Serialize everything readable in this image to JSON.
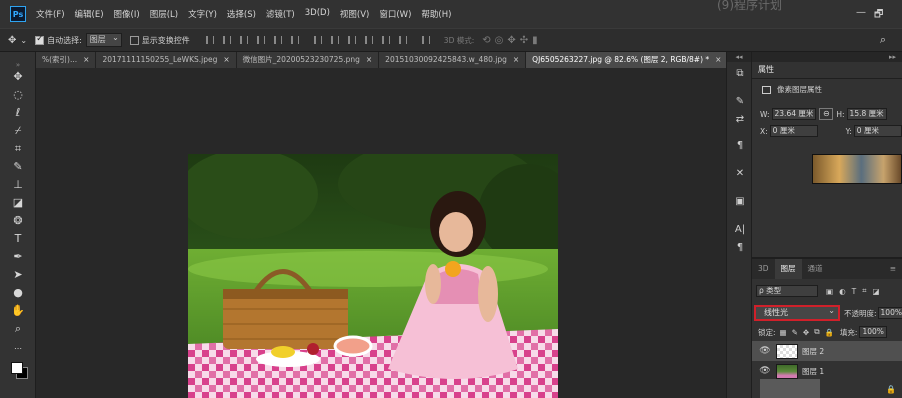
{
  "app": {
    "logo": "Ps",
    "menus": [
      "文件(F)",
      "编辑(E)",
      "图像(I)",
      "图层(L)",
      "文字(Y)",
      "选择(S)",
      "滤镜(T)",
      "3D(D)",
      "视图(V)",
      "窗口(W)",
      "帮助(H)"
    ],
    "top_faded_text": "(9)程序计划",
    "window_controls": {
      "minimize": "—",
      "restore": "🗗"
    }
  },
  "options": {
    "auto_select_label": "自动选择:",
    "auto_select_checked": true,
    "auto_select_value": "图层",
    "show_transform_label": "显示变换控件",
    "show_transform_checked": false,
    "mode_3d": "3D 模式:"
  },
  "tabs": [
    {
      "label": "%(索引)... ",
      "active": false
    },
    {
      "label": "20171111150255_LeWKS.jpeg",
      "active": false
    },
    {
      "label": "微信图片_20200523230725.png",
      "active": false
    },
    {
      "label": "20151030092425843.w_480.jpg",
      "active": false
    },
    {
      "label": "QJ6505263227.jpg @ 82.6% (图层 2, RGB/8#) *",
      "active": true
    }
  ],
  "tabs_more": "»",
  "right_col": {
    "collapse": "◂◂"
  },
  "properties": {
    "collapse": "▸▸",
    "tab_label": "属性",
    "section_label": "像素图层属性",
    "w_label": "W:",
    "w_value": "23.64 厘米",
    "h_label": "H:",
    "h_value": "15.8 厘米",
    "x_label": "X:",
    "x_value": "0 厘米",
    "y_label": "Y:",
    "y_value": "0 厘米"
  },
  "layers": {
    "tabs": [
      {
        "label": "3D",
        "active": false
      },
      {
        "label": "图层",
        "active": true
      },
      {
        "label": "通道",
        "active": false
      }
    ],
    "filter_label": "ρ 类型",
    "blend_mode": "线性光",
    "opacity_label": "不透明度:",
    "opacity_value": "100%",
    "lock_label": "锁定:",
    "fill_label": "填充:",
    "fill_value": "100%",
    "items": [
      {
        "name": "图层 2",
        "selected": true,
        "thumb": "transparent"
      },
      {
        "name": "图层 1",
        "selected": false,
        "thumb": "image"
      }
    ]
  },
  "colors": {
    "accent_red": "#d0202a",
    "ps_blue": "#31a8ff"
  }
}
